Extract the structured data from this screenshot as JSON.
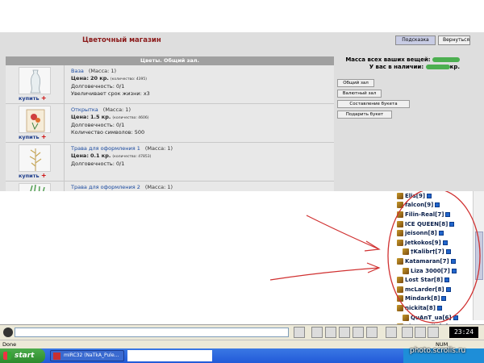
{
  "shop": {
    "title": "Цветочный магазин",
    "hint_button": "Подсказка",
    "back_button": "Вернуться",
    "table_title": "Цветы. Общий зал.",
    "buy_label": "купить",
    "buy_plus": "+",
    "items": [
      {
        "name": "Ваза",
        "mass": "(Масса: 1)",
        "price_label": "Цена:",
        "price": "20 кр.",
        "qty": "(количество: 4395)",
        "lines": [
          "Долговечность: 0/1",
          "Увеличивает срок жизни: x3"
        ]
      },
      {
        "name": "Открытка",
        "mass": "(Масса: 1)",
        "price_label": "Цена:",
        "price": "1.5 кр.",
        "qty": "(количество: 4606)",
        "lines": [
          "Долговечность: 0/1",
          "Количество символов: 500"
        ]
      },
      {
        "name": "Трава для оформления 1",
        "mass": "(Масса: 1)",
        "price_label": "Цена:",
        "price": "0.1 кр.",
        "qty": "(количество: 47853)",
        "lines": [
          "Долговечность: 0/1"
        ]
      },
      {
        "name": "Трава для оформления 2",
        "mass": "(Масса: 1)",
        "price_label": "",
        "price": "",
        "qty": "",
        "lines": []
      }
    ],
    "mass_label": "Масса всех ваших вещей:",
    "money_label": "У вас в наличии:",
    "money_suffix": "кр.",
    "side_buttons": [
      "Общий зал",
      "Валютный зал",
      "Составление букета",
      "Подарить букет"
    ]
  },
  "chat": {
    "users": [
      {
        "name": "Elis[9]",
        "indent": false
      },
      {
        "name": "falcon[9]",
        "indent": false
      },
      {
        "name": "Filin-Real[7]",
        "indent": false
      },
      {
        "name": "ICE QUEEN[8]",
        "indent": false
      },
      {
        "name": "jeisonn[8]",
        "indent": false
      },
      {
        "name": "Jetkokos[9]",
        "indent": false
      },
      {
        "name": "†Kalibr†[7]",
        "indent": true
      },
      {
        "name": "Katamaran[7]",
        "indent": false
      },
      {
        "name": "Liza 3000[7]",
        "indent": true
      },
      {
        "name": "Lost Star[8]",
        "indent": false
      },
      {
        "name": "mcLarder[8]",
        "indent": false
      },
      {
        "name": "Mindark[8]",
        "indent": false
      },
      {
        "name": "nickita[8]",
        "indent": false
      },
      {
        "name": "QuAnT_ua[6]",
        "indent": true
      },
      {
        "name": "Simourelle[8]",
        "indent": false
      }
    ],
    "clock": "23:24"
  },
  "status": {
    "left": "Done",
    "num": "NUM"
  },
  "taskbar": {
    "start": "start",
    "task": "mIRC32 (NaTkA_Pule..."
  },
  "watermark": "photo.scrolls.ru",
  "colors": {
    "title_red": "#8b1a1a",
    "link_blue": "#1a4aa0",
    "annotation_red": "#d03030",
    "censor_green": "#4caf50"
  }
}
